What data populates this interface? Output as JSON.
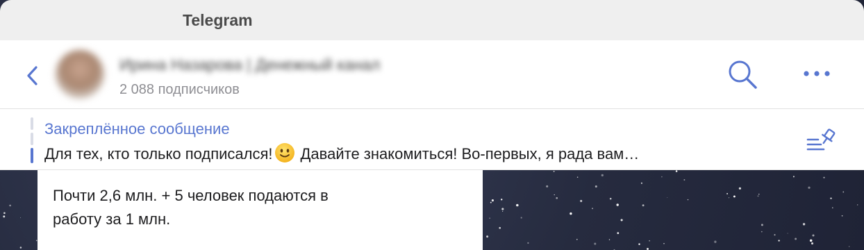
{
  "app": {
    "title": "Telegram"
  },
  "header": {
    "channel_name": "Ирина Назарова | Денежный канал",
    "subscribers": "2 088 подписчиков",
    "back_icon": "chevron-left-icon",
    "search_icon": "search-icon",
    "more_icon": "more-horizontal-icon"
  },
  "pinned": {
    "title": "Закреплённое сообщение",
    "text_before_emoji": "Для тех, кто только подписался!",
    "emoji": "slightly-smiling-face",
    "text_after_emoji": "Давайте знакомиться!   Во-первых, я рада вам…",
    "list_icon": "pinned-list-icon"
  },
  "message": {
    "line1": "Почти 2,6 млн. + 5 человек подаются в",
    "line2": "работу за 1 млн."
  },
  "colors": {
    "accent": "#5876d0",
    "secondary_text": "#8e8e93",
    "primary_text": "#1c1c1e"
  }
}
